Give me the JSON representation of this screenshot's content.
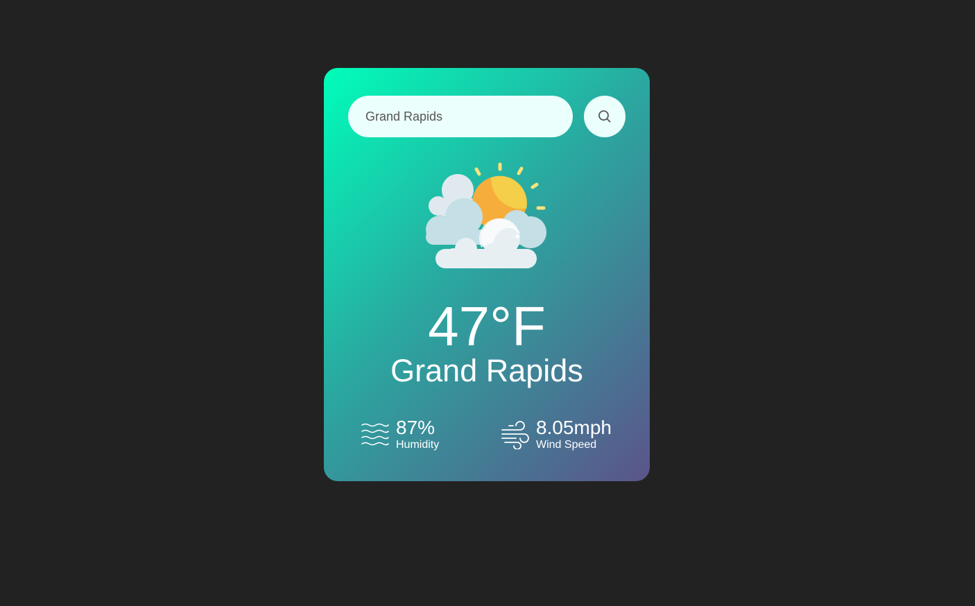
{
  "search": {
    "value": "Grand Rapids",
    "placeholder": "Enter city name"
  },
  "weather": {
    "icon": "partly-cloudy-icon",
    "temperature": "47°F",
    "city": "Grand Rapids"
  },
  "details": {
    "humidity_value": "87%",
    "humidity_label": "Humidity",
    "wind_value": "8.05mph",
    "wind_label": "Wind Speed"
  },
  "colors": {
    "background": "#222222",
    "gradient_start": "#00feba",
    "gradient_end": "#5b548a",
    "input_background": "#ebfffc"
  }
}
